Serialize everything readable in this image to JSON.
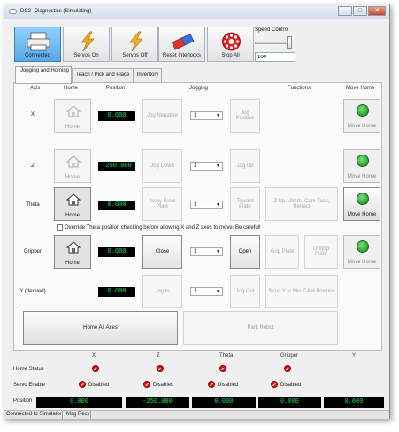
{
  "window": {
    "title": "DC2- Diagnostics (Simulating)"
  },
  "toolbar": {
    "connected_label": "Connected",
    "servos_on_label": "Servos On",
    "servos_off_label": "Servos Off",
    "reset_interlocks_label": "Reset Interlocks",
    "stop_all_label": "Stop All",
    "speed_control_label": "Speed Control",
    "speed_value": "100",
    "speed_fraction": 1.0
  },
  "tabs": [
    {
      "label": "Jogging and Homing"
    },
    {
      "label": "Teach / Pick and Place"
    },
    {
      "label": "Inventory"
    }
  ],
  "headers": {
    "axis": "Axis",
    "home": "Home",
    "position": "Position",
    "jogging": "Jogging",
    "functions": "Functions",
    "move_home": "Move Home"
  },
  "rows": [
    {
      "axis": "X",
      "home": "Home",
      "position": "0.000",
      "neg": "Jog Negative",
      "step": "1",
      "posj": "Jog Positive",
      "move_home": "Move Home"
    },
    {
      "axis": "Z",
      "home": "Home",
      "position": "-250.000",
      "neg": "Jog Down",
      "step": "1",
      "posj": "Jog Up",
      "move_home": "Move Home"
    },
    {
      "axis": "Theta",
      "home": "Home",
      "position": "0.000",
      "neg": "Away From Plate",
      "step": "1",
      "posj": "Toward Plate",
      "func1": "Z Up 10mm, Cam Tuck, Retract",
      "move_home": "Move Home"
    },
    {
      "axis": "Gripper",
      "home": "Home",
      "position": "0.000",
      "neg": "Close",
      "step": "1",
      "posj": "Open",
      "func1": "Grip Plate",
      "func2": "Ungrip Plate",
      "move_home": "Move Home"
    },
    {
      "axis": "Y (derived)",
      "position": "0.000",
      "neg": "Jog In",
      "step": "1",
      "posj": "Jog Out",
      "func1": "Send Y to Min CAM Position"
    }
  ],
  "override_text": "Override Theta position checking before allowing X and Z axes to move. Be careful!",
  "home_all_label": "Home All Axes",
  "park_robot_label": "Park Robot",
  "status": {
    "axes": [
      "X",
      "Z",
      "Theta",
      "Gripper",
      "Y"
    ],
    "home_status_label": "Home Status",
    "servo_enable_label": "Servo Enable",
    "disabled_text": "Disabled",
    "position_label": "Position",
    "positions": [
      "0.000",
      "-250.000",
      "0.000",
      "0.000",
      "0.000"
    ]
  },
  "statusbar": {
    "connection": "Connected to Simulator",
    "msg": "Msg Recv"
  },
  "colors": {
    "readout_green": "#18e35a",
    "connected_blue": "#58a9e6"
  },
  "icons": {
    "connected": "printer-icon",
    "servos": "lightning-icon",
    "reset": "eraser-icon",
    "stop": "stop-wheel-icon",
    "home": "house-icon",
    "move_home": "running-man-icon",
    "disabled": "no-entry-icon"
  }
}
